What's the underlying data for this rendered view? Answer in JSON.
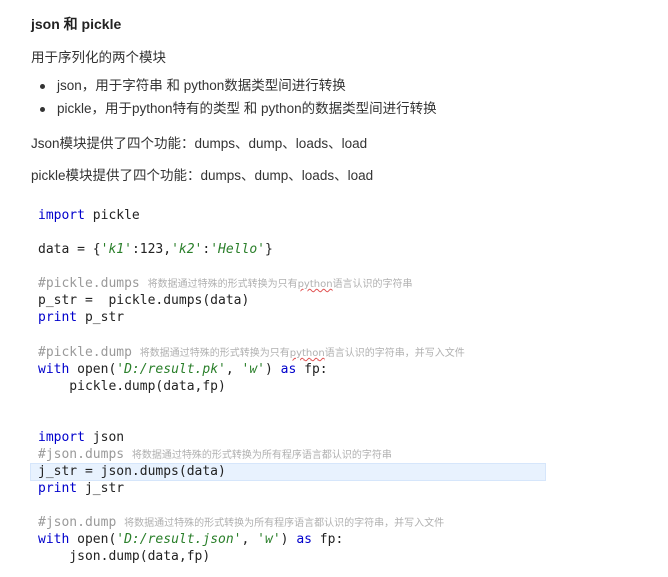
{
  "heading": "json 和 pickle",
  "intro": "用于序列化的两个模块",
  "bullets": [
    "json，用于字符串 和 python数据类型间进行转换",
    "pickle，用于python特有的类型 和 python的数据类型间进行转换"
  ],
  "json_funcs": "Json模块提供了四个功能：dumps、dump、loads、load",
  "pickle_funcs": "pickle模块提供了四个功能：dumps、dump、loads、load",
  "code": {
    "l1_kw": "import",
    "l1_rest": " pickle",
    "l2_a": "data = {",
    "l2_k1": "'k1'",
    "l2_b": ":123,",
    "l2_k2": "'k2'",
    "l2_c": ":",
    "l2_v": "'Hello'",
    "l2_d": "}",
    "c1_code": "#pickle.dumps ",
    "c1_text_a": "将数据通过特殊的形式转换为只有",
    "c1_sq": "python",
    "c1_text_b": "语言认识的字符串",
    "l3": "p_str =  pickle.dumps(data)",
    "l4_kw": "print",
    "l4_rest": " p_str",
    "c2_code": "#pickle.dump ",
    "c2_text_a": "将数据通过特殊的形式转换为只有",
    "c2_sq": "python",
    "c2_text_b": "语言认识的字符串，并写入文件",
    "l5_kw1": "with",
    "l5_a": " open(",
    "l5_s1": "'D:/result.pk'",
    "l5_b": ", ",
    "l5_s2": "'w'",
    "l5_c": ") ",
    "l5_kw2": "as",
    "l5_d": " fp:",
    "l6": "    pickle.dump(data,fp)",
    "l7_kw": "import",
    "l7_rest": " json",
    "c3_code": "#json.dumps ",
    "c3_text": "将数据通过特殊的形式转换为所有程序语言都认识的字符串",
    "l8": "j_str = json.dumps(data)",
    "l9_kw": "print",
    "l9_rest": " j_str",
    "c4_code": "#json.dump ",
    "c4_text": "将数据通过特殊的形式转换为所有程序语言都认识的字符串，并写入文件",
    "l10_kw1": "with",
    "l10_a": " open(",
    "l10_s1": "'D:/result.json'",
    "l10_b": ", ",
    "l10_s2": "'w'",
    "l10_c": ") ",
    "l10_kw2": "as",
    "l10_d": " fp:",
    "l11": "    json.dump(data,fp)"
  }
}
